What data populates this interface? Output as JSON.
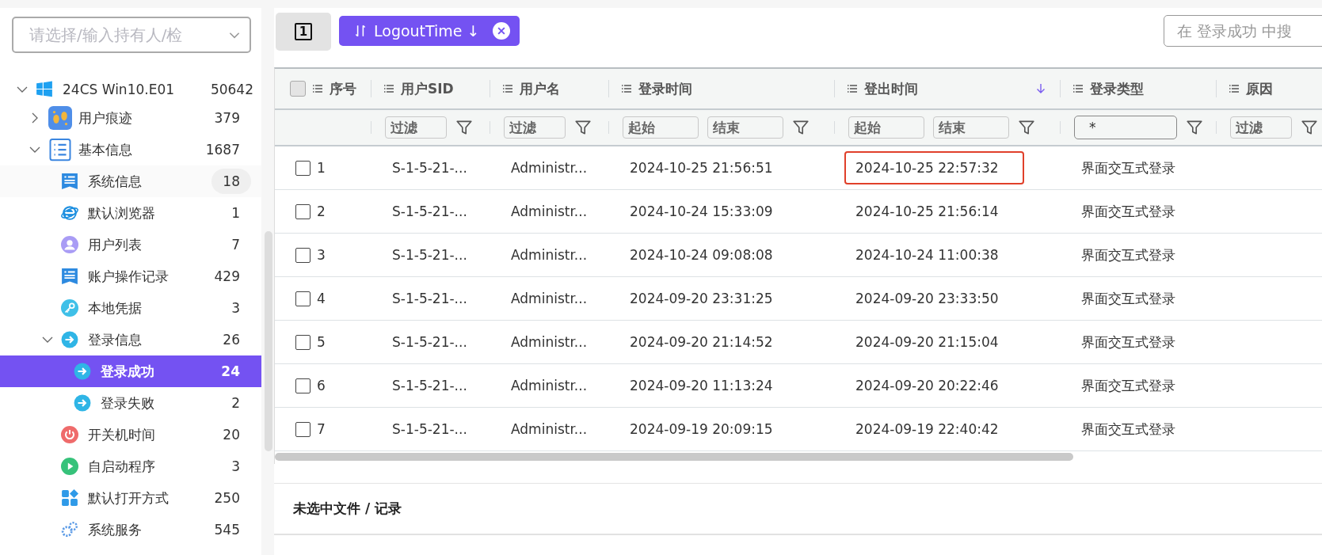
{
  "sidebar": {
    "owner_select": {
      "placeholder": "请选择/输入持有人/检"
    },
    "tree": [
      {
        "label": "24CS  Win10.E01",
        "count": "50642",
        "kind": "windows",
        "expanded": true,
        "selected": false,
        "highlighted": false,
        "children": [
          {
            "label": "用户痕迹",
            "count": "379",
            "kind": "footprints",
            "expanded": false,
            "selected": false,
            "highlighted": false
          },
          {
            "label": "基本信息",
            "count": "1687",
            "kind": "list",
            "expanded": true,
            "selected": false,
            "highlighted": false,
            "children": [
              {
                "label": "系统信息",
                "count": "18",
                "kind": "document",
                "selected": false,
                "highlighted": true
              },
              {
                "label": "默认浏览器",
                "count": "1",
                "kind": "browser",
                "selected": false,
                "highlighted": false
              },
              {
                "label": "用户列表",
                "count": "7",
                "kind": "user",
                "selected": false,
                "highlighted": false
              },
              {
                "label": "账户操作记录",
                "count": "429",
                "kind": "document",
                "selected": false,
                "highlighted": false
              },
              {
                "label": "本地凭据",
                "count": "3",
                "kind": "key",
                "selected": false,
                "highlighted": false
              },
              {
                "label": "登录信息",
                "count": "26",
                "kind": "login",
                "expanded": true,
                "selected": false,
                "highlighted": false,
                "children": [
                  {
                    "label": "登录成功",
                    "count": "24",
                    "kind": "login",
                    "selected": true,
                    "highlighted": false
                  },
                  {
                    "label": "登录失败",
                    "count": "2",
                    "kind": "login",
                    "selected": false,
                    "highlighted": false
                  }
                ]
              },
              {
                "label": "开关机时间",
                "count": "20",
                "kind": "power",
                "selected": false,
                "highlighted": false
              },
              {
                "label": "自启动程序",
                "count": "3",
                "kind": "play",
                "selected": false,
                "highlighted": false
              },
              {
                "label": "默认打开方式",
                "count": "250",
                "kind": "apps",
                "selected": false,
                "highlighted": false
              },
              {
                "label": "系统服务",
                "count": "545",
                "kind": "gear",
                "selected": false,
                "highlighted": false
              }
            ]
          }
        ]
      }
    ]
  },
  "toolbar": {
    "page_button": "1",
    "sort_tag": {
      "label": "LogoutTime ↓"
    },
    "search": {
      "placeholder": "在 登录成功 中搜"
    }
  },
  "table": {
    "columns": [
      {
        "label": "序号",
        "sorted": false,
        "filter": {
          "kind": "none"
        }
      },
      {
        "label": "用户SID",
        "sorted": false,
        "filter": {
          "kind": "text",
          "placeholder": "过滤"
        }
      },
      {
        "label": "用户名",
        "sorted": false,
        "filter": {
          "kind": "text",
          "placeholder": "过滤"
        }
      },
      {
        "label": "登录时间",
        "sorted": false,
        "filter": {
          "kind": "range",
          "start": {
            "placeholder": "起始"
          },
          "end": {
            "placeholder": "结束"
          }
        }
      },
      {
        "label": "登出时间",
        "sorted": true,
        "filter": {
          "kind": "range",
          "start": {
            "placeholder": "起始"
          },
          "end": {
            "placeholder": "结束"
          }
        }
      },
      {
        "label": "登录类型",
        "sorted": false,
        "filter": {
          "kind": "select",
          "value": "*"
        }
      },
      {
        "label": "原因",
        "filter": {
          "kind": "text",
          "placeholder": "过滤"
        }
      }
    ],
    "all_checked": false,
    "rows": [
      {
        "checked": false,
        "outlined": true,
        "cells": [
          "1",
          "S-1-5-21-...",
          "Administr...",
          "2024-10-25 21:56:51",
          "2024-10-25 22:57:32",
          "界面交互式登录"
        ]
      },
      {
        "checked": false,
        "outlined": false,
        "cells": [
          "2",
          "S-1-5-21-...",
          "Administr...",
          "2024-10-24 15:33:09",
          "2024-10-25 21:56:14",
          "界面交互式登录"
        ]
      },
      {
        "checked": false,
        "outlined": false,
        "cells": [
          "3",
          "S-1-5-21-...",
          "Administr...",
          "2024-10-24 09:08:08",
          "2024-10-24 11:00:38",
          "界面交互式登录"
        ]
      },
      {
        "checked": false,
        "outlined": false,
        "cells": [
          "4",
          "S-1-5-21-...",
          "Administr...",
          "2024-09-20 23:31:25",
          "2024-09-20 23:33:50",
          "界面交互式登录"
        ]
      },
      {
        "checked": false,
        "outlined": false,
        "cells": [
          "5",
          "S-1-5-21-...",
          "Administr...",
          "2024-09-20 21:14:52",
          "2024-09-20 21:15:04",
          "界面交互式登录"
        ]
      },
      {
        "checked": false,
        "outlined": false,
        "cells": [
          "6",
          "S-1-5-21-...",
          "Administr...",
          "2024-09-20 11:13:24",
          "2024-09-20 20:22:46",
          "界面交互式登录"
        ]
      },
      {
        "checked": false,
        "outlined": false,
        "cells": [
          "7",
          "S-1-5-21-...",
          "Administr...",
          "2024-09-19 20:09:15",
          "2024-09-19 22:40:42",
          "界面交互式登录"
        ]
      }
    ]
  },
  "detail_panel": {
    "title": "未选中文件 / 记录"
  }
}
